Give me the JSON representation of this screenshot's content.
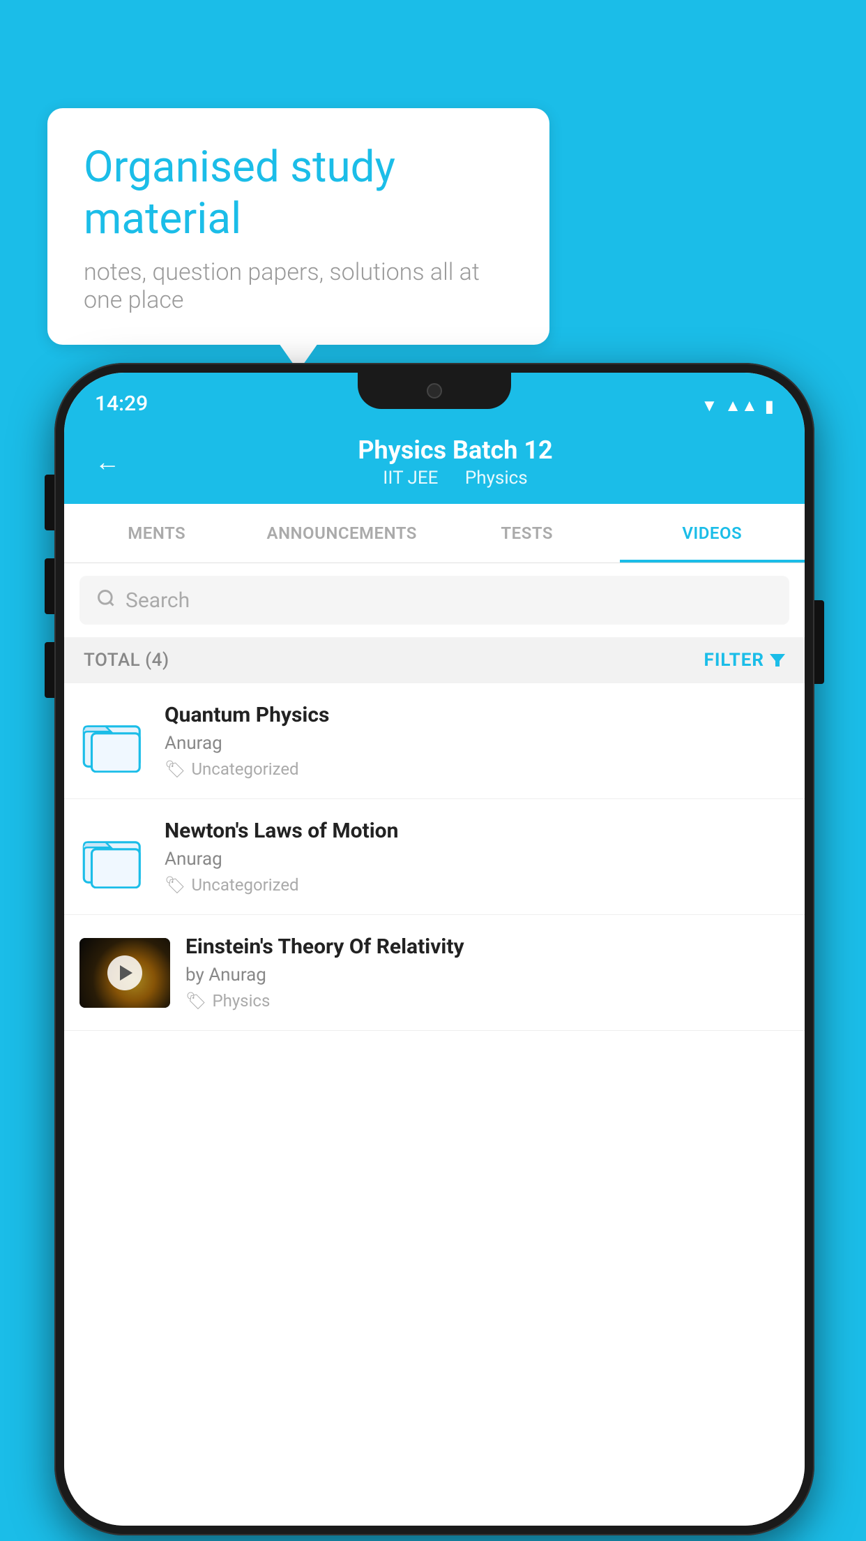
{
  "background_color": "#1bbde8",
  "speech_bubble": {
    "title": "Organised study material",
    "subtitle": "notes, question papers, solutions all at one place"
  },
  "phone": {
    "status_bar": {
      "time": "14:29"
    },
    "header": {
      "back_label": "←",
      "title": "Physics Batch 12",
      "tag1": "IIT JEE",
      "tag2": "Physics"
    },
    "tabs": [
      {
        "label": "MENTS",
        "active": false
      },
      {
        "label": "ANNOUNCEMENTS",
        "active": false
      },
      {
        "label": "TESTS",
        "active": false
      },
      {
        "label": "VIDEOS",
        "active": true
      }
    ],
    "search": {
      "placeholder": "Search"
    },
    "filter_row": {
      "total": "TOTAL (4)",
      "filter_label": "FILTER"
    },
    "videos": [
      {
        "id": 1,
        "title": "Quantum Physics",
        "author": "Anurag",
        "tag": "Uncategorized",
        "has_thumbnail": false
      },
      {
        "id": 2,
        "title": "Newton's Laws of Motion",
        "author": "Anurag",
        "tag": "Uncategorized",
        "has_thumbnail": false
      },
      {
        "id": 3,
        "title": "Einstein's Theory Of Relativity",
        "author": "by Anurag",
        "tag": "Physics",
        "has_thumbnail": true
      }
    ]
  }
}
